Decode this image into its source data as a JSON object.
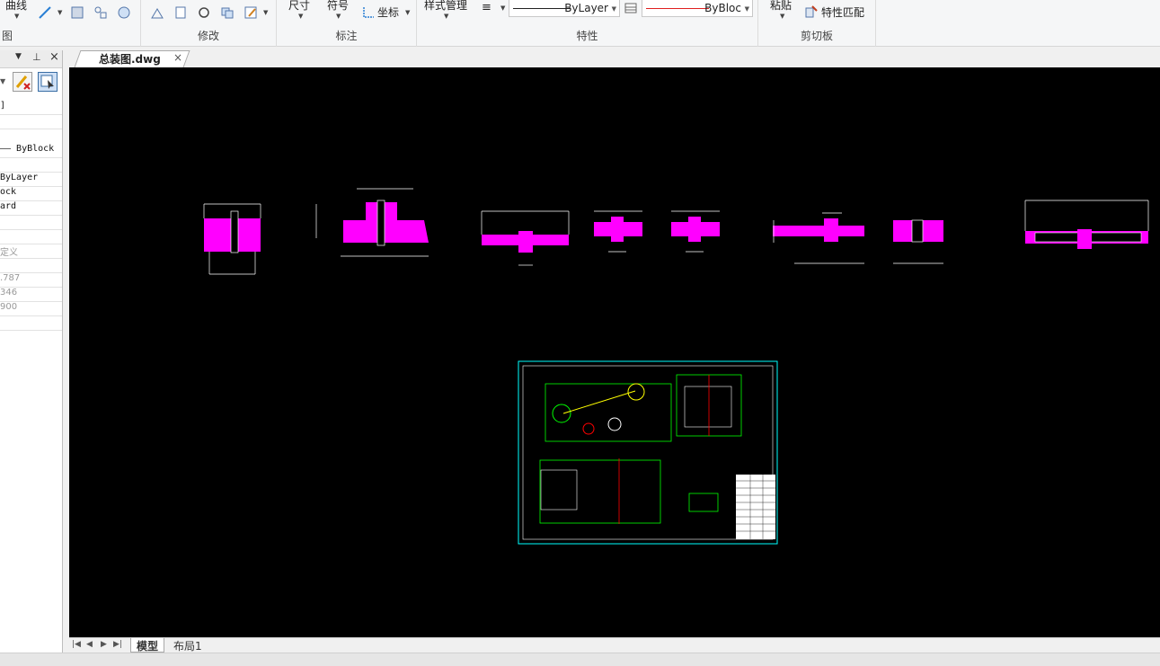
{
  "ribbon": {
    "groups": {
      "draw": {
        "label": "图",
        "curve_label": "曲线"
      },
      "modify": {
        "label": "修改"
      },
      "annotation": {
        "label": "标注",
        "dimension_label": "尺寸",
        "symbol_label": "符号",
        "coordinate_label": "坐标"
      },
      "properties": {
        "label": "特性",
        "style_manager_label": "样式管理",
        "linetype_value": "ByLayer",
        "color_value": "ByBloc"
      },
      "clipboard": {
        "label": "剪切板",
        "paste_label": "粘贴",
        "match_props_label": "特性匹配"
      }
    }
  },
  "left_panel": {
    "rows": [
      {
        "text": "]"
      },
      {
        "text": ""
      },
      {
        "text": "—— ByBlock"
      },
      {
        "text": ""
      },
      {
        "text": "   ByLayer"
      },
      {
        "text": "ock"
      },
      {
        "text": "ard"
      },
      {
        "text": ""
      },
      {
        "text": ""
      },
      {
        "text": "定义"
      },
      {
        "text": ""
      },
      {
        "text": ".787"
      },
      {
        "text": "346"
      },
      {
        "text": "900"
      },
      {
        "text": ""
      }
    ]
  },
  "document_tab": {
    "title": "总装图.dwg",
    "close": "×"
  },
  "layout_tabs": {
    "model": "模型",
    "layout1": "布局1"
  },
  "colors": {
    "canvas": "#000000",
    "hatch": "#ff00ff",
    "drawing_line": "#ffffff",
    "frame": "#00ffff",
    "assembly_lines": "#00ff00",
    "accent_red": "#ff0000"
  }
}
